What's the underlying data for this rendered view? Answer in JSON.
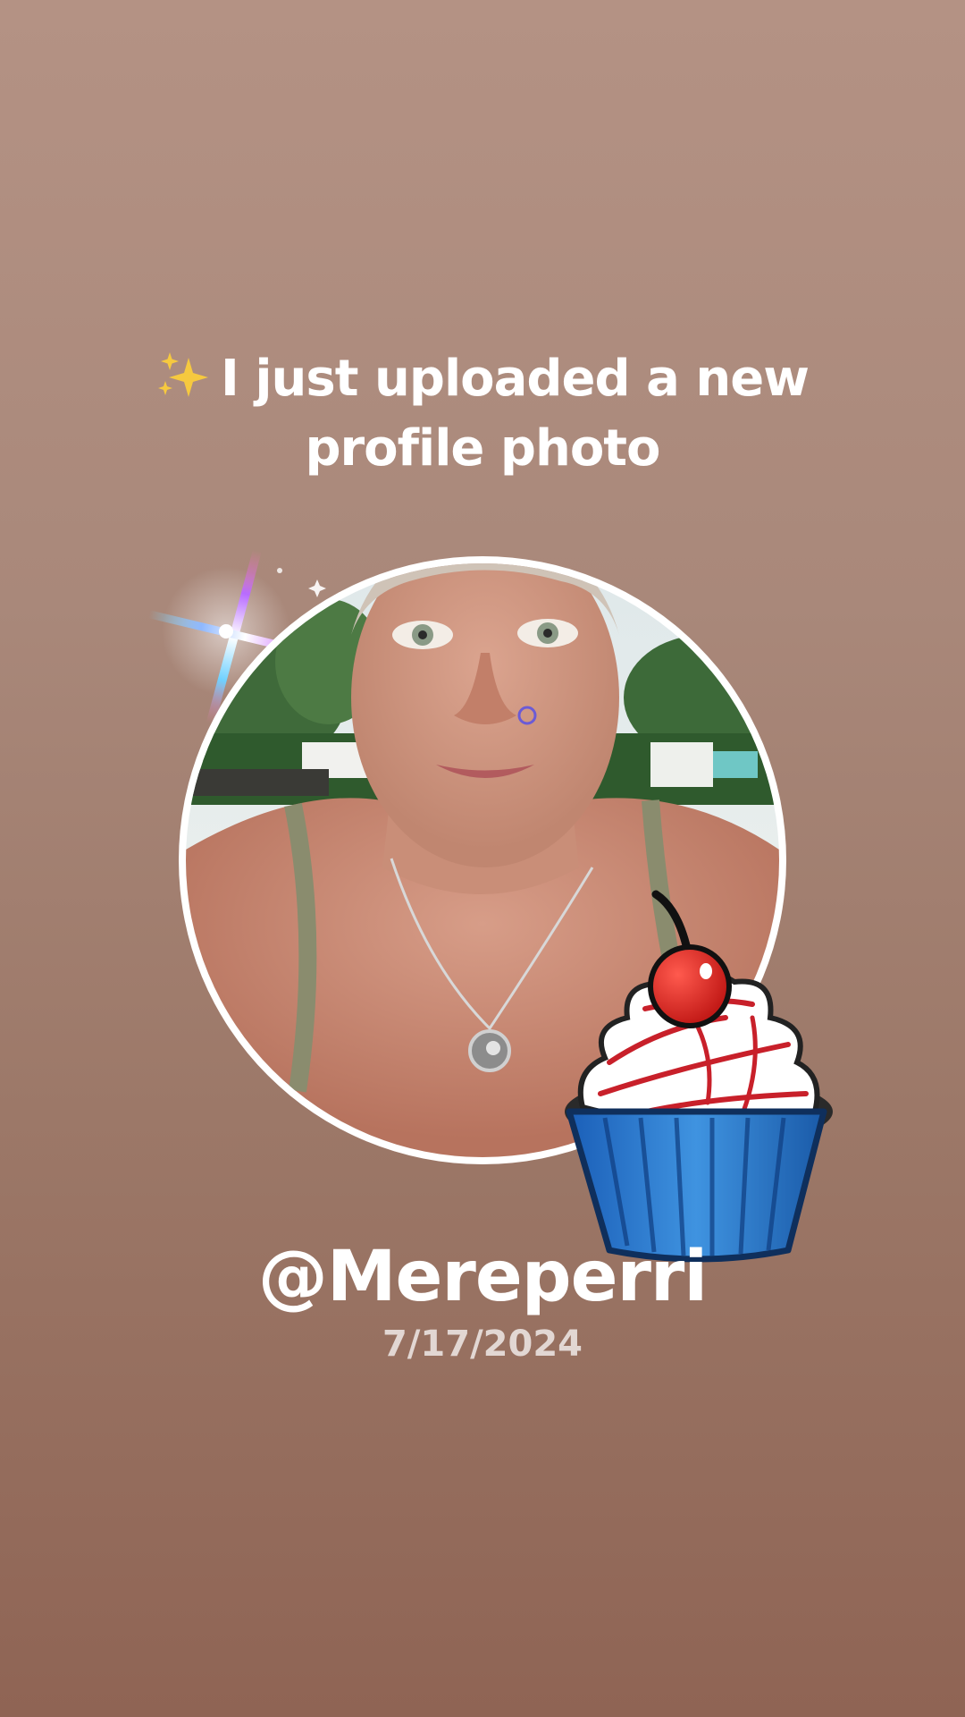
{
  "announcement": {
    "icon": "sparkles-icon",
    "line1": "I just uploaded a new",
    "line2": "profile photo"
  },
  "profile": {
    "username": "@Mereperri",
    "date": "7/17/2024",
    "photo_icon": "profile-photo",
    "sticker_icon": "cupcake-sticker"
  },
  "colors": {
    "background_top": "#b49284",
    "background_bottom": "#8f6454",
    "text": "#ffffff",
    "date_text": "#d9c7bf",
    "avatar_border": "#ffffff"
  }
}
